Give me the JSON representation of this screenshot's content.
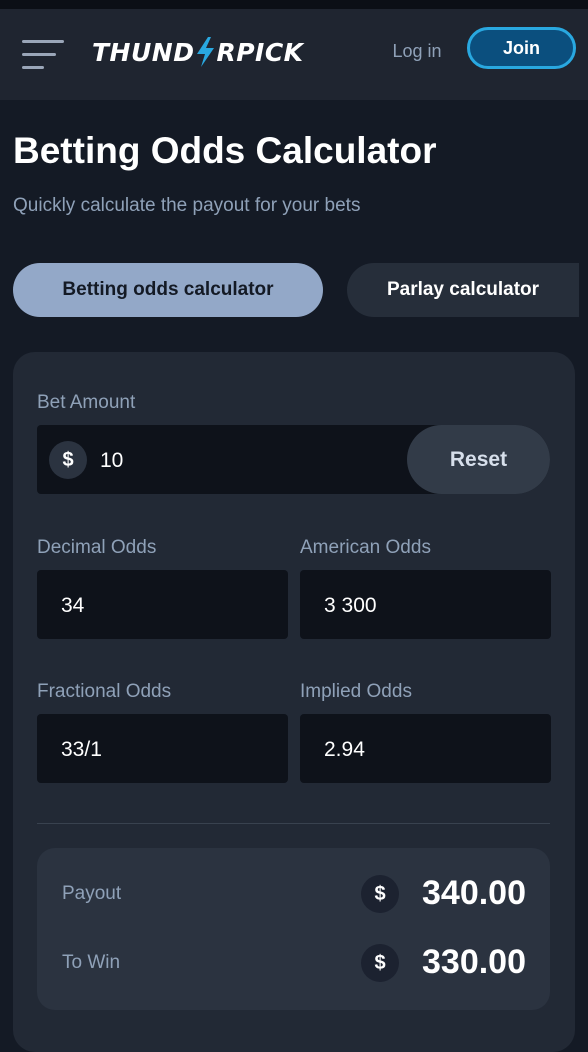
{
  "header": {
    "logo_left": "THUND",
    "logo_right": "RPICK",
    "login_label": "Log in",
    "join_label": "Join"
  },
  "page": {
    "title": "Betting Odds Calculator",
    "subtitle": "Quickly calculate the payout for your bets"
  },
  "tabs": [
    {
      "label": "Betting odds calculator",
      "active": true
    },
    {
      "label": "Parlay calculator",
      "active": false
    }
  ],
  "calculator": {
    "bet_amount_label": "Bet Amount",
    "currency_symbol": "$",
    "bet_amount_value": "10",
    "reset_label": "Reset",
    "decimal_label": "Decimal Odds",
    "decimal_value": "34",
    "american_label": "American Odds",
    "american_value": "3 300",
    "fractional_label": "Fractional Odds",
    "fractional_value": "33/1",
    "implied_label": "Implied Odds",
    "implied_value": "2.94"
  },
  "results": {
    "payout_label": "Payout",
    "payout_value": "340.00",
    "to_win_label": "To Win",
    "to_win_value": "330.00"
  },
  "colors": {
    "background": "#141a25",
    "header": "#1f2530",
    "accent": "#29a8e0",
    "active_tab": "#93a8c8",
    "muted_text": "#8fa1b8"
  },
  "icons": {
    "menu": "hamburger-menu-icon",
    "logo_bolt": "lightning-bolt-icon",
    "currency": "dollar-icon"
  }
}
